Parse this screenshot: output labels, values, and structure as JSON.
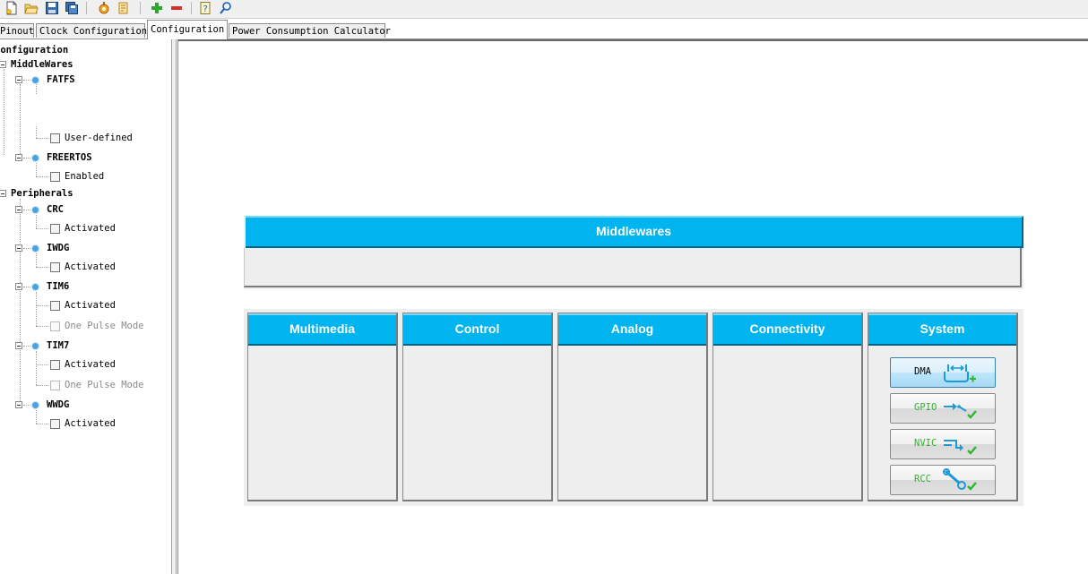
{
  "toolbar": {
    "icons": [
      "new-project-icon",
      "open-icon",
      "save-icon",
      "save-as-icon",
      "generate-code-icon",
      "generate-report-icon",
      "zoom-in-icon",
      "zoom-out-icon",
      "help-icon",
      "about-icon"
    ]
  },
  "tabs": [
    {
      "label": "Pinout"
    },
    {
      "label": "Clock Configuration"
    },
    {
      "label": "Configuration"
    },
    {
      "label": "Power Consumption Calculator"
    }
  ],
  "tree": {
    "root": "Configuration",
    "middlewares": {
      "label": "MiddleWares",
      "items": [
        {
          "name": "FATFS",
          "options": [
            {
              "label": "User-defined",
              "enabled": true
            }
          ]
        },
        {
          "name": "FREERTOS",
          "options": [
            {
              "label": "Enabled",
              "enabled": true
            }
          ]
        }
      ]
    },
    "peripherals": {
      "label": "Peripherals",
      "items": [
        {
          "name": "CRC",
          "options": [
            {
              "label": "Activated",
              "enabled": true
            }
          ]
        },
        {
          "name": "IWDG",
          "options": [
            {
              "label": "Activated",
              "enabled": true
            }
          ]
        },
        {
          "name": "TIM6",
          "options": [
            {
              "label": "Activated",
              "enabled": true
            },
            {
              "label": "One Pulse Mode",
              "enabled": false
            }
          ]
        },
        {
          "name": "TIM7",
          "options": [
            {
              "label": "Activated",
              "enabled": true
            },
            {
              "label": "One Pulse Mode",
              "enabled": false
            }
          ]
        },
        {
          "name": "WWDG",
          "options": [
            {
              "label": "Activated",
              "enabled": true
            }
          ]
        }
      ]
    }
  },
  "main": {
    "middlewares_title": "Middlewares",
    "categories": [
      {
        "label": "Multimedia"
      },
      {
        "label": "Control"
      },
      {
        "label": "Analog"
      },
      {
        "label": "Connectivity"
      },
      {
        "label": "System"
      }
    ],
    "system_buttons": [
      {
        "label": "DMA",
        "icon": "dma-icon"
      },
      {
        "label": "GPIO",
        "icon": "gpio-icon"
      },
      {
        "label": "NVIC",
        "icon": "nvic-icon"
      },
      {
        "label": "RCC",
        "icon": "rcc-icon"
      }
    ]
  },
  "colors": {
    "header_blue": "#00b4ef",
    "panel_grey": "#eeeeee",
    "check_green": "#2db52d",
    "icon_blue": "#1a9ad6"
  }
}
